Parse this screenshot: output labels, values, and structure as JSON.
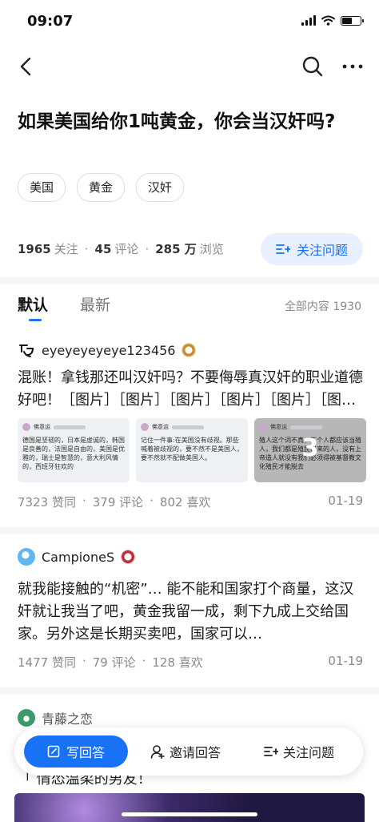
{
  "status": {
    "time": "09:07"
  },
  "question": {
    "title": "如果美国给你1吨黄金，你会当汉奸吗?",
    "tags": [
      "美国",
      "黄金",
      "汉奸"
    ],
    "followers": "1965",
    "followers_label": "关注",
    "comments": "45",
    "comments_label": "评论",
    "views": "285 万",
    "views_label": "浏览",
    "follow_button": "关注问题"
  },
  "tabs": {
    "default": "默认",
    "latest": "最新",
    "all_count": "全部内容 1930"
  },
  "answers": [
    {
      "author": "eyeyeyeyeye123456",
      "content": "混账！拿钱那还叫汉奸吗？不要侮辱真汉奸的职业道德好吧！［图片］［图片］［图片］［图片］［图片］［图…",
      "images": [
        {
          "author": "佛意运",
          "text": "德国是坚韧的，日本是虚诚的，韩国是良善的，法国是自由的，美国是优雅的，瑞士是智慧的，意大利风情的，西班牙狂欢的"
        },
        {
          "author": "佛意运",
          "text": "记住一件事:在美国没有歧视。那些喊着被歧视的，要不然不是美国人，要不然就不配做美国人。"
        },
        {
          "author": "佛意运",
          "text": "殖人这个词不真，不个人都应该当殖人，我们都是殖民出来的人，没有上帝造人就没有我们必须得被基督教文化殖民才能脱去"
        }
      ],
      "more_images": "3",
      "likes": "7323 赞同",
      "comments": "379 评论",
      "favs": "802 喜欢",
      "date": "01-19"
    },
    {
      "author": "CampioneS",
      "content": "就我能接触的“机密”… 能不能和国家打个商量，这汉奸就让我当了吧，黄金我留一成，剩下九成上交给国家。另外这是长期买卖吧，国家可以…",
      "likes": "1477 赞同",
      "comments": "79 评论",
      "favs": "128 喜欢",
      "date": "01-19"
    },
    {
      "author": "青藤之恋",
      "preview": "「 情怂温柔的男友！"
    }
  ],
  "bottom_bar": {
    "write": "写回答",
    "invite": "邀请回答",
    "follow": "关注问题"
  },
  "colors": {
    "accent": "#1772f6",
    "accent_light": "#e8f0ff",
    "text_gray": "#8a8a8a"
  }
}
